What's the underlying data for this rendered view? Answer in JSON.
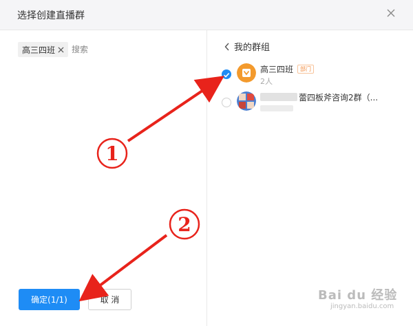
{
  "dialog": {
    "title": "选择创建直播群"
  },
  "left": {
    "selected_chip": "高三四班",
    "search_placeholder": "搜索",
    "confirm_label": "确定(1/1)",
    "cancel_label": "取 消"
  },
  "right": {
    "back_label": "我的群组",
    "groups": [
      {
        "name": "高三四班",
        "tag": "部门",
        "count": "2人",
        "checked": true
      },
      {
        "name": "蕾四板斧咨询2群（...",
        "count": "",
        "checked": false
      }
    ]
  },
  "annotations": {
    "label_1": "1",
    "label_2": "2",
    "color": "#e8231b"
  },
  "watermark": {
    "brand": "Bai du 经验",
    "url": "jingyan.baidu.com"
  },
  "colors": {
    "accent": "#1e8cf5",
    "header_bg": "#f5f5f7",
    "tag": "#f28a3c"
  }
}
